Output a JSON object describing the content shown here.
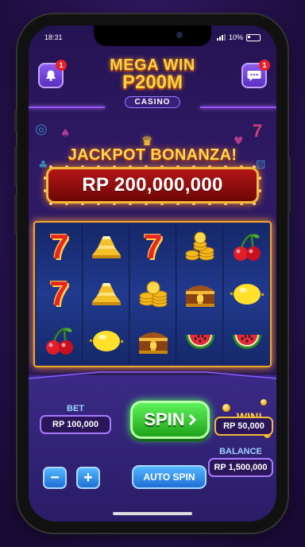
{
  "status_bar": {
    "time": "18:31",
    "battery": "10%"
  },
  "header": {
    "logo_line1": "MEGA WIN",
    "logo_line2": "P200M",
    "logo_sub": "CASINO",
    "notifications_badge": "1",
    "chat_badge": "1"
  },
  "jackpot": {
    "title": "JACKPOT BONANZA!",
    "amount": "RP 200,000,000"
  },
  "reels": [
    [
      "seven",
      "seven",
      "cherry"
    ],
    [
      "gold-bar",
      "gold-bar",
      "lemon"
    ],
    [
      "seven",
      "coins",
      "treasure-chest"
    ],
    [
      "coins",
      "treasure-chest",
      "watermelon"
    ],
    [
      "cherry",
      "lemon",
      "watermelon"
    ]
  ],
  "controls": {
    "bet_label": "BET",
    "bet_value": "RP 100,000",
    "spin_label": "SPIN",
    "win_label": "WIN!",
    "win_value": "RP 50,000",
    "balance_label": "BALANCE",
    "balance_value": "RP 1,500,000",
    "minus_label": "−",
    "plus_label": "+",
    "auto_spin_label": "AUTO SPIN"
  },
  "colors": {
    "accent_gold": "#ffd23a",
    "spin_green": "#1ea31a",
    "jackpot_red": "#b31616",
    "button_blue": "#1f6fd6",
    "panel_purple": "#2a1c66"
  }
}
